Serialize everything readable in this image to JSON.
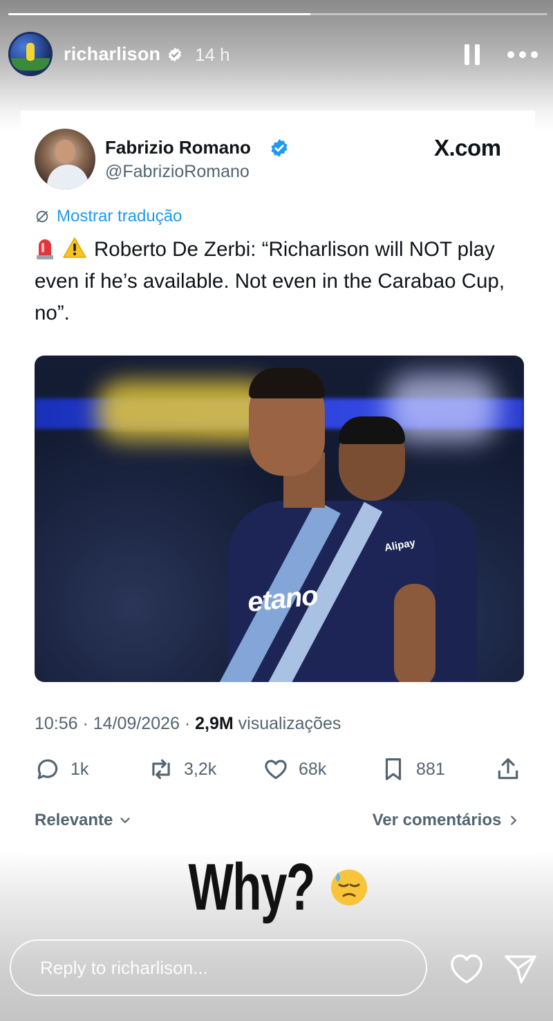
{
  "story": {
    "progress": 0.56,
    "username": "richarlison",
    "time_ago": "14 h",
    "verified": true
  },
  "tweet": {
    "author_name": "Fabrizio Romano",
    "author_handle": "@FabrizioRomano",
    "source": "X.com",
    "translate_label": "Mostrar tradução",
    "text": "Roberto De Zerbi: “Richarlison will NOT play even if he’s available. Not even in the Carabao Cup, no”.",
    "emojis": [
      "siren",
      "warning"
    ],
    "photo_text": {
      "sponsor": "etano",
      "sleeve": "Alipay"
    },
    "time": "10:56",
    "date": "14/09/2026",
    "views_count": "2,9M",
    "views_label": "visualizações",
    "replies": "1k",
    "retweets": "3,2k",
    "likes": "68k",
    "bookmarks": "881",
    "sort_label": "Relevante",
    "comments_link": "Ver comentários"
  },
  "caption": {
    "text": "Why?",
    "emoji": "downcast-face-with-sweat"
  },
  "reply": {
    "placeholder": "Reply to richarlison..."
  },
  "colors": {
    "x_blue": "#1d9bf0",
    "text_dark": "#0f1419",
    "text_muted": "#536471"
  }
}
